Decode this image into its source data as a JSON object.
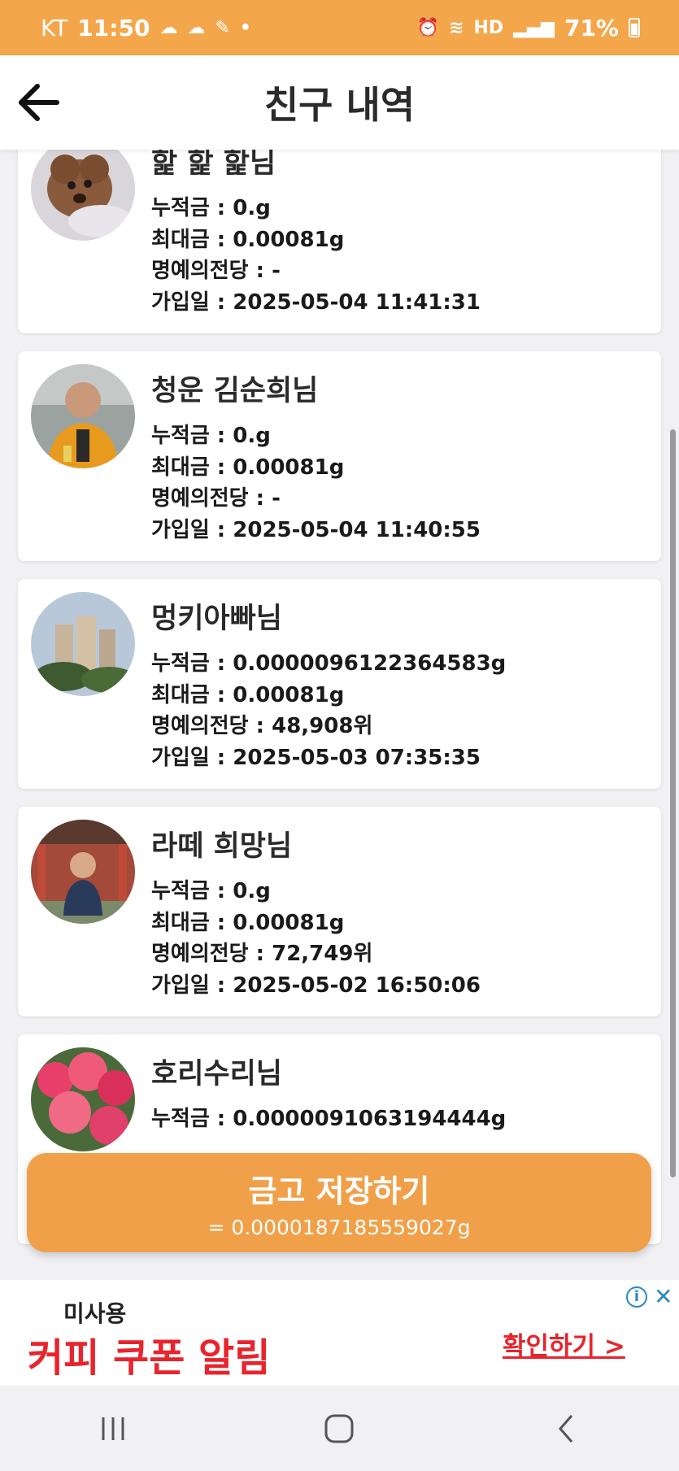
{
  "status_bar": {
    "carrier": "KT",
    "time": "11:50",
    "battery": "71%"
  },
  "header": {
    "title": "친구 내역"
  },
  "labels": {
    "accumulated": "누적금 : ",
    "max": "최대금 : ",
    "hall_of_fame": "명예의전당 : ",
    "joined": "가입일 : "
  },
  "friends": [
    {
      "name": "핥 핥 핥님",
      "accumulated": "0.g",
      "max": "0.00081g",
      "hall_of_fame": "-",
      "joined": "2025-05-04 11:41:31"
    },
    {
      "name": "청운 김순희님",
      "accumulated": "0.g",
      "max": "0.00081g",
      "hall_of_fame": "-",
      "joined": "2025-05-04 11:40:55"
    },
    {
      "name": "멍키아빠님",
      "accumulated": "0.0000096122364583g",
      "max": "0.00081g",
      "hall_of_fame": "48,908위",
      "joined": "2025-05-03 07:35:35"
    },
    {
      "name": "라떼 희망님",
      "accumulated": "0.g",
      "max": "0.00081g",
      "hall_of_fame": "72,749위",
      "joined": "2025-05-02 16:50:06"
    },
    {
      "name": "호리수리님",
      "accumulated": "0.0000091063194444g",
      "max": "",
      "hall_of_fame": "",
      "joined": ""
    }
  ],
  "save_button": {
    "label": "금고 저장하기",
    "amount": "= 0.0000187185559027g"
  },
  "ad": {
    "subtitle": "미사용",
    "title": "커피 쿠폰 알림",
    "cta": "확인하기 >"
  },
  "colors": {
    "accent": "#f3a64a",
    "ad_red": "#e8242c"
  }
}
